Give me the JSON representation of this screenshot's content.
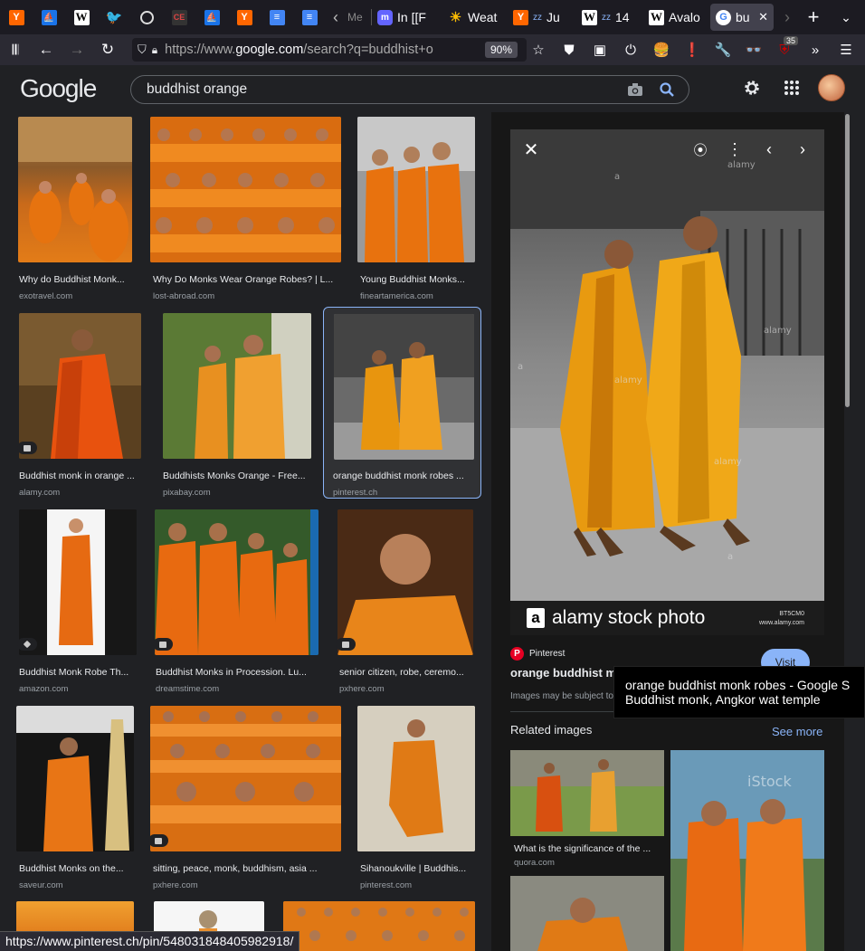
{
  "browser": {
    "tabs": [
      {
        "icon": "hacker-news-icon"
      },
      {
        "icon": "sailboat-icon"
      },
      {
        "icon": "wikipedia-icon"
      },
      {
        "icon": "twitter-icon"
      },
      {
        "icon": "globe-icon"
      },
      {
        "icon": "ce-icon"
      },
      {
        "icon": "sailboat-icon"
      },
      {
        "icon": "hacker-news-icon"
      },
      {
        "icon": "docs-icon"
      },
      {
        "icon": "docs-icon"
      }
    ],
    "named_tabs": [
      {
        "label": "Me",
        "icon": "mastodon-icon"
      },
      {
        "label": "In [[F",
        "icon": "mastodon-icon"
      },
      {
        "label": "Weat",
        "icon": "weather-icon"
      },
      {
        "label": "Ju",
        "icon": "hacker-news-icon"
      },
      {
        "label": "14",
        "icon": "wikipedia-icon"
      },
      {
        "label": "Avalo",
        "icon": "wikipedia-icon"
      },
      {
        "label": "bu",
        "icon": "google-icon"
      }
    ],
    "url_prefix": "https://www.",
    "url_host": "google.com",
    "url_rest": "/search?q=buddhist+o",
    "zoom": "90%",
    "extension_badge": "35",
    "status_url": "https://www.pinterest.ch/pin/548031848405982918/"
  },
  "google": {
    "logo": "Google",
    "query": "buddhist orange"
  },
  "results": [
    {
      "title": "Why do Buddhist Monk...",
      "source": "exotravel.com"
    },
    {
      "title": "Why Do Monks Wear Orange Robes? | L...",
      "source": "lost-abroad.com"
    },
    {
      "title": "Young Buddhist Monks...",
      "source": "fineartamerica.com"
    },
    {
      "title": "Buddhist monk in orange ...",
      "source": "alamy.com"
    },
    {
      "title": "Buddhists Monks Orange - Free...",
      "source": "pixabay.com"
    },
    {
      "title": "orange buddhist monk robes ...",
      "source": "pinterest.ch"
    },
    {
      "title": "Buddhist Monk Robe Th...",
      "source": "amazon.com"
    },
    {
      "title": "Buddhist Monks in Procession. Lu...",
      "source": "dreamstime.com"
    },
    {
      "title": "senior citizen, robe, ceremo...",
      "source": "pxhere.com"
    },
    {
      "title": "Buddhist Monks on the...",
      "source": "saveur.com"
    },
    {
      "title": "sitting, peace, monk, buddhism, asia ...",
      "source": "pxhere.com"
    },
    {
      "title": "Sihanoukville | Buddhis...",
      "source": "pinterest.com"
    }
  ],
  "preview": {
    "alamy_brand": "alamy stock photo",
    "alamy_id": "BT5CM0",
    "alamy_site": "www.alamy.com",
    "source_name": "Pinterest",
    "title": "orange buddhist monk robes - Google Search",
    "visit_label": "Visit",
    "copyright_note": "Images may be subject to copyright.",
    "related_label": "Related images",
    "see_more_label": "See more",
    "related": [
      {
        "title": "What is the significance of the ...",
        "source": "quora.com"
      }
    ]
  },
  "tooltip": {
    "line1": "orange buddhist monk robes - Google S",
    "line2": "Buddhist  monk, Angkor wat temple"
  }
}
